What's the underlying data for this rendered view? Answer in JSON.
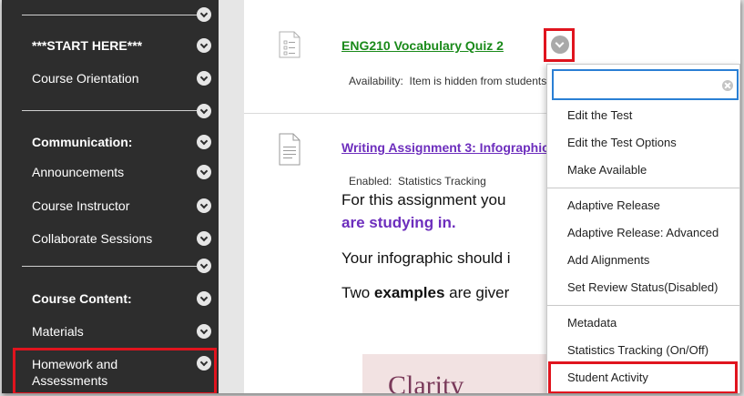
{
  "sidebar": {
    "items": [
      {
        "label": "***START HERE***",
        "bold": true
      },
      {
        "label": "Course Orientation",
        "bold": false
      },
      {
        "label": "Communication:",
        "bold": true
      },
      {
        "label": "Announcements",
        "bold": false
      },
      {
        "label": "Course Instructor",
        "bold": false
      },
      {
        "label": "Collaborate Sessions",
        "bold": false
      },
      {
        "label": "Course Content:",
        "bold": true
      },
      {
        "label": "Materials",
        "bold": false
      },
      {
        "label": "Homework and Assessments",
        "bold": false
      }
    ]
  },
  "content": {
    "item1": {
      "title": "ENG210 Vocabulary Quiz 2",
      "meta_label": "Availability:",
      "meta_value": "Item is hidden from students"
    },
    "item2": {
      "title": "Writing Assignment 3: Infographic",
      "meta_label": "Enabled:",
      "meta_value": "Statistics Tracking",
      "line1": "For this assignment you",
      "line2": "are studying in.",
      "line3": "Your infographic should i",
      "line4_pre": "Two ",
      "line4_bold": "examples",
      "line4_post": " are giver",
      "image_text": "Clarity"
    }
  },
  "menu": {
    "search_value": "",
    "items": [
      "Edit the Test",
      "Edit the Test Options",
      "Make Available",
      "Adaptive Release",
      "Adaptive Release: Advanced",
      "Add Alignments",
      "Set Review Status(Disabled)",
      "Metadata",
      "Statistics Tracking (On/Off)",
      "Student Activity"
    ]
  },
  "colors": {
    "sidebar_bg": "#2d2d2d",
    "title_green": "#1a8a1a",
    "title_purple": "#6d2ebd",
    "highlight_red": "#e0141e",
    "search_border": "#2a7fd4"
  }
}
